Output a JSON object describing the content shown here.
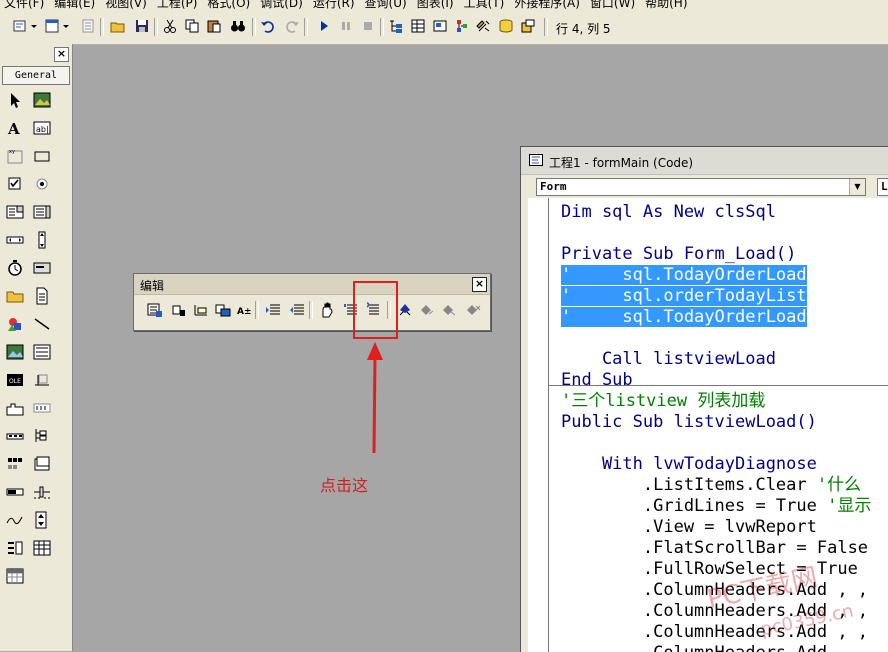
{
  "menubar": {
    "items": [
      "文件(F)",
      "编辑(E)",
      "视图(V)",
      "工程(P)",
      "格式(O)",
      "调试(D)",
      "运行(R)",
      "查询(U)",
      "图表(I)",
      "工具(T)",
      "外接程序(A)",
      "窗口(W)",
      "帮助(H)"
    ]
  },
  "toolbar": {
    "position": "行 4, 列 5"
  },
  "toolbox": {
    "close": "×",
    "tab": "General",
    "tools": [
      "pointer",
      "picture-box",
      "label",
      "text-box",
      "frame",
      "command-button",
      "check-box",
      "option-button",
      "combo-box",
      "list-box",
      "h-scroll-bar",
      "v-scroll-bar",
      "timer",
      "drive-list",
      "dir-list",
      "file-list",
      "shape",
      "line",
      "image",
      "data",
      "ole",
      "common-dialog",
      "tab-strip",
      "toolbar",
      "status-bar",
      "tree-view",
      "image-list",
      "list-view",
      "progress-bar",
      "slider",
      "graph",
      "up-down",
      "data-combo",
      "data-grid",
      "flex-grid"
    ]
  },
  "editbar": {
    "title": "编辑",
    "close": "×",
    "buttons": [
      "list-properties",
      "list-constants",
      "quick-info",
      "parameter-info",
      "complete-word",
      "indent",
      "outdent",
      "toggle-breakpoint",
      "comment-block",
      "uncomment-block",
      "toggle-bookmark",
      "next-bookmark",
      "previous-bookmark",
      "clear-all-bookmarks"
    ]
  },
  "annotation": {
    "text": "点击这",
    "color": "#e01e1e"
  },
  "codewin": {
    "title": "工程1 - formMain (Code)",
    "object": "Form",
    "procedure": "L",
    "lines": [
      {
        "parts": [
          {
            "t": "Dim sql As New clsSql",
            "c": "kw"
          }
        ]
      },
      {
        "parts": []
      },
      {
        "parts": [
          {
            "t": "Private Sub Form_Load()",
            "c": "kw"
          }
        ]
      },
      {
        "parts": [
          {
            "t": "'     sql.TodayOrderLoad",
            "c": "sel"
          }
        ]
      },
      {
        "parts": [
          {
            "t": "'     sql.orderTodayList",
            "c": "sel"
          }
        ]
      },
      {
        "parts": [
          {
            "t": "'     sql.TodayOrderLoad",
            "c": "sel"
          }
        ]
      },
      {
        "parts": []
      },
      {
        "parts": [
          {
            "t": "    Call listviewLoad",
            "c": "kw"
          }
        ]
      },
      {
        "parts": [
          {
            "t": "End Sub",
            "c": "kw"
          }
        ]
      },
      {
        "parts": [
          {
            "t": "'三个listview 列表加载",
            "c": "cm"
          }
        ]
      },
      {
        "parts": [
          {
            "t": "Public Sub listviewLoad()",
            "c": "kw"
          }
        ]
      },
      {
        "parts": []
      },
      {
        "parts": [
          {
            "t": "    With lvwTodayDiagnose",
            "c": "kw"
          }
        ]
      },
      {
        "parts": [
          {
            "t": "        .ListItems.Clear ",
            "c": ""
          },
          {
            "t": "'什么",
            "c": "cm"
          }
        ]
      },
      {
        "parts": [
          {
            "t": "        .GridLines = True ",
            "c": ""
          },
          {
            "t": "'显示",
            "c": "cm"
          }
        ]
      },
      {
        "parts": [
          {
            "t": "        .View = lvwReport",
            "c": ""
          }
        ]
      },
      {
        "parts": [
          {
            "t": "        .FlatScrollBar = False",
            "c": ""
          }
        ]
      },
      {
        "parts": [
          {
            "t": "        .FullRowSelect = True",
            "c": ""
          }
        ]
      },
      {
        "parts": [
          {
            "t": "        .ColumnHeaders.Add , ,",
            "c": ""
          }
        ]
      },
      {
        "parts": [
          {
            "t": "        .ColumnHeaders.Add , ,",
            "c": ""
          }
        ]
      },
      {
        "parts": [
          {
            "t": "        .ColumnHeaders.Add , ,",
            "c": ""
          }
        ]
      },
      {
        "parts": [
          {
            "t": "        .ColumnHeaders.Add , ,",
            "c": ""
          }
        ]
      }
    ]
  },
  "watermark": {
    "line1": "PC下载网",
    "line2": "pc0359.cn"
  }
}
